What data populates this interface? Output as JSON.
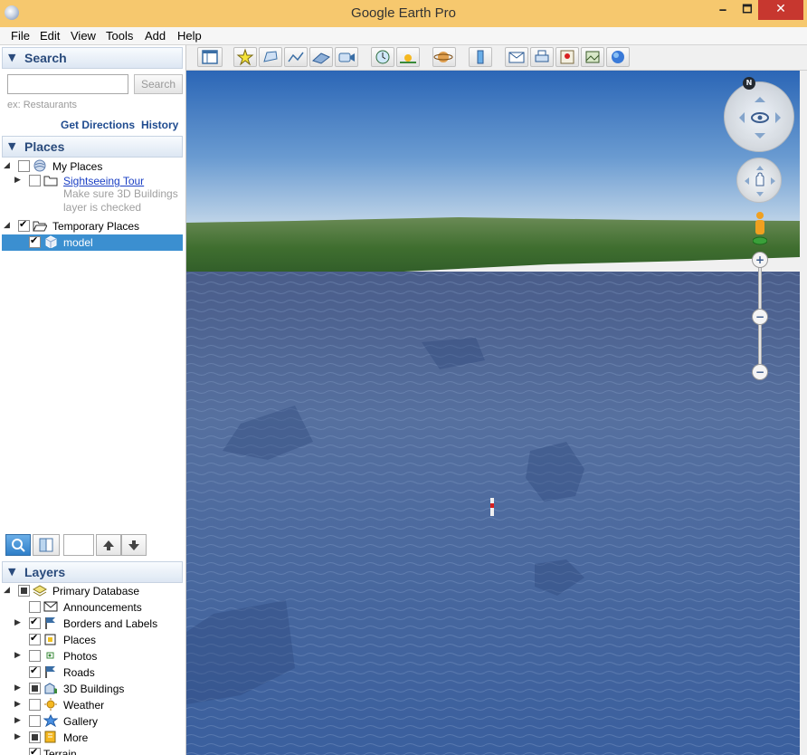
{
  "window": {
    "title": "Google Earth Pro",
    "minimize_label": "🗕",
    "maximize_label": "🗖",
    "close_label": "✕"
  },
  "menu": {
    "items": [
      {
        "label": "File",
        "underline": "F"
      },
      {
        "label": "Edit",
        "underline": "E"
      },
      {
        "label": "View",
        "underline": "V"
      },
      {
        "label": "Tools",
        "underline": "T"
      },
      {
        "label": "Add",
        "underline": "A"
      },
      {
        "label": "Help",
        "underline": "H"
      }
    ]
  },
  "search": {
    "title": "Search",
    "input_value": "",
    "button_label": "Search",
    "hint": "ex: Restaurants",
    "get_directions": "Get Directions",
    "history": "History"
  },
  "places": {
    "title": "Places",
    "my_places": "My Places",
    "sightseeing_tour": "Sightseeing Tour",
    "tour_note_line1": "Make sure 3D Buildings",
    "tour_note_line2": "layer is checked",
    "temporary_places": "Temporary Places",
    "model": "model"
  },
  "layers": {
    "title": "Layers",
    "primary_database": "Primary Database",
    "items": [
      {
        "label": "Announcements",
        "checked": false,
        "expandable": false,
        "icon": "envelope-icon"
      },
      {
        "label": "Borders and Labels",
        "checked": true,
        "expandable": true,
        "icon": "flag-icon"
      },
      {
        "label": "Places",
        "checked": true,
        "expandable": false,
        "icon": "places-icon"
      },
      {
        "label": "Photos",
        "checked": false,
        "expandable": true,
        "icon": "photo-icon"
      },
      {
        "label": "Roads",
        "checked": true,
        "expandable": false,
        "icon": "road-icon"
      },
      {
        "label": "3D Buildings",
        "checked": "partial",
        "expandable": true,
        "icon": "buildings-icon"
      },
      {
        "label": "Weather",
        "checked": false,
        "expandable": true,
        "icon": "sun-icon"
      },
      {
        "label": "Gallery",
        "checked": false,
        "expandable": true,
        "icon": "star-icon"
      },
      {
        "label": "More",
        "checked": "partial",
        "expandable": true,
        "icon": "more-icon"
      },
      {
        "label": "Terrain",
        "checked": true,
        "expandable": false,
        "icon": ""
      }
    ]
  },
  "navigation": {
    "north_label": "N"
  },
  "colors": {
    "titlebar": "#f6c86e",
    "panel_header_text": "#2a4b7c",
    "selection": "#3b8fd0",
    "sky_top": "#2b66b6",
    "ocean": "#3f5f9c"
  }
}
